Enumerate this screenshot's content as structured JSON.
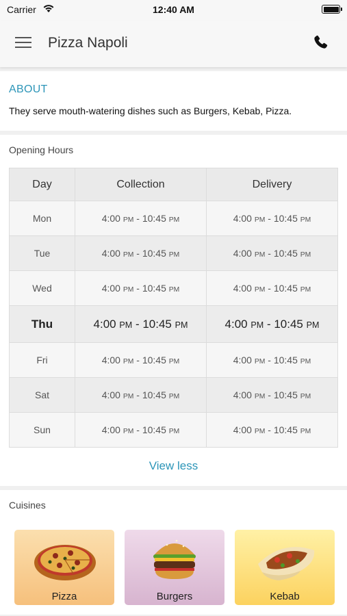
{
  "status_bar": {
    "carrier": "Carrier",
    "time": "12:40 AM"
  },
  "header": {
    "title": "Pizza Napoli",
    "menu_icon": "hamburger-menu-icon",
    "phone_icon": "phone-icon"
  },
  "about": {
    "heading": "ABOUT",
    "description": "They serve mouth-watering dishes such as Burgers, Kebab, Pizza."
  },
  "opening_hours": {
    "heading": "Opening Hours",
    "columns": [
      "Day",
      "Collection",
      "Delivery"
    ],
    "today": "Thu",
    "rows": [
      {
        "day": "Mon",
        "collection": [
          "4:00",
          "PM",
          "10:45",
          "PM"
        ],
        "delivery": [
          "4:00",
          "PM",
          "10:45",
          "PM"
        ]
      },
      {
        "day": "Tue",
        "collection": [
          "4:00",
          "PM",
          "10:45",
          "PM"
        ],
        "delivery": [
          "4:00",
          "PM",
          "10:45",
          "PM"
        ]
      },
      {
        "day": "Wed",
        "collection": [
          "4:00",
          "PM",
          "10:45",
          "PM"
        ],
        "delivery": [
          "4:00",
          "PM",
          "10:45",
          "PM"
        ]
      },
      {
        "day": "Thu",
        "collection": [
          "4:00",
          "PM",
          "10:45",
          "PM"
        ],
        "delivery": [
          "4:00",
          "PM",
          "10:45",
          "PM"
        ]
      },
      {
        "day": "Fri",
        "collection": [
          "4:00",
          "PM",
          "10:45",
          "PM"
        ],
        "delivery": [
          "4:00",
          "PM",
          "10:45",
          "PM"
        ]
      },
      {
        "day": "Sat",
        "collection": [
          "4:00",
          "PM",
          "10:45",
          "PM"
        ],
        "delivery": [
          "4:00",
          "PM",
          "10:45",
          "PM"
        ]
      },
      {
        "day": "Sun",
        "collection": [
          "4:00",
          "PM",
          "10:45",
          "PM"
        ],
        "delivery": [
          "4:00",
          "PM",
          "10:45",
          "PM"
        ]
      }
    ],
    "toggle_label": "View less"
  },
  "cuisines": {
    "heading": "Cuisines",
    "items": [
      {
        "label": "Pizza",
        "icon": "pizza-image"
      },
      {
        "label": "Burgers",
        "icon": "burger-image"
      },
      {
        "label": "Kebab",
        "icon": "kebab-image"
      }
    ]
  },
  "colors": {
    "accent": "#2c95b8",
    "background": "#f0f0f0"
  }
}
